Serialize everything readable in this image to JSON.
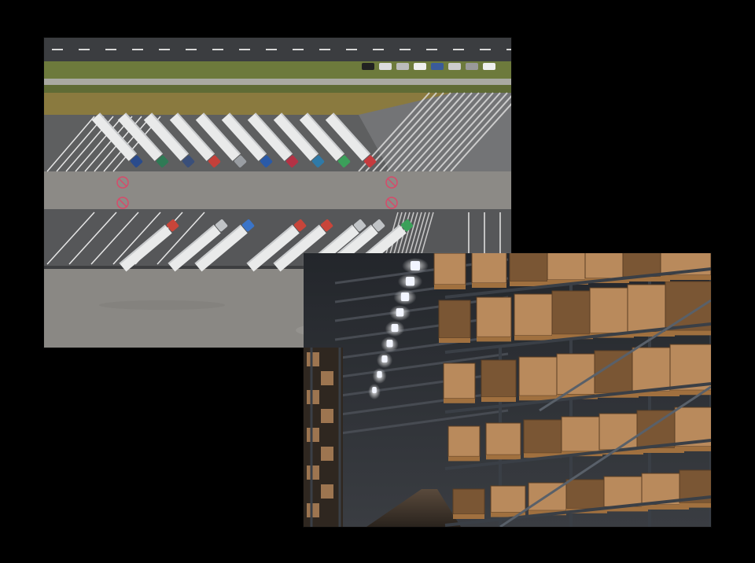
{
  "scene": {
    "background": "#000000",
    "photos": [
      {
        "id": "aerial",
        "subject": "truck-parking-lot",
        "colors": {
          "asphalt": "#5e5f60",
          "pavement": "#8c8a86",
          "grass": "#6d7a3c",
          "dry_grass": "#8a7a3f",
          "road": "#3b3d40",
          "trailer": "#e9eaea"
        },
        "top_row_cab_colors": [
          "#2a4b8c",
          "#2f7a55",
          "#3a4f7a",
          "#c4403a",
          "#9a9ea3",
          "#2a5aa8",
          "#b43245",
          "#2f7aa8",
          "#3ba05a",
          "#c63b3e"
        ],
        "bottom_row_cab_colors": [
          "#c8453a",
          "#c0c3c6",
          "#3a74c8",
          "#c8453a",
          "#c8453a",
          "#c0c3c6",
          "#c0c3c6",
          "#3ba05a"
        ]
      },
      {
        "id": "warehouse",
        "subject": "warehouse-racking-with-boxes",
        "colors": {
          "ceiling": "#2b2e33",
          "light": "#f2f5ff",
          "box": "#b98a5c",
          "box_dark": "#7a5634",
          "rack": "#3a3f46"
        },
        "ceiling_lights": 9
      }
    ]
  }
}
